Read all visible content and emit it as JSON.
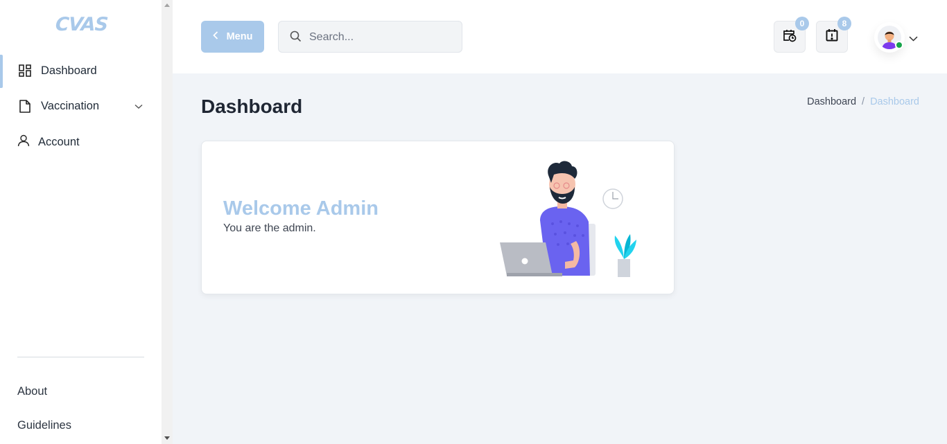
{
  "app": {
    "logo_text": "CVAS",
    "accent_color": "#a9c9ea"
  },
  "sidebar": {
    "items": [
      {
        "label": "Dashboard",
        "icon": "dashboard-grid-icon",
        "active": true
      },
      {
        "label": "Vaccination",
        "icon": "document-icon",
        "expandable": true
      },
      {
        "label": "Account",
        "icon": "user-icon"
      }
    ],
    "footer_links": [
      {
        "label": "About"
      },
      {
        "label": "Guidelines"
      }
    ]
  },
  "header": {
    "menu_label": "Menu",
    "search_placeholder": "Search...",
    "search_value": "",
    "appointments_count": "0",
    "alerts_count": "8",
    "user_status": "online"
  },
  "main": {
    "page_title": "Dashboard",
    "breadcrumb": {
      "parent": "Dashboard",
      "separator": "/",
      "current": "Dashboard"
    },
    "welcome_title": "Welcome Admin",
    "welcome_subtitle": "You are the admin."
  }
}
